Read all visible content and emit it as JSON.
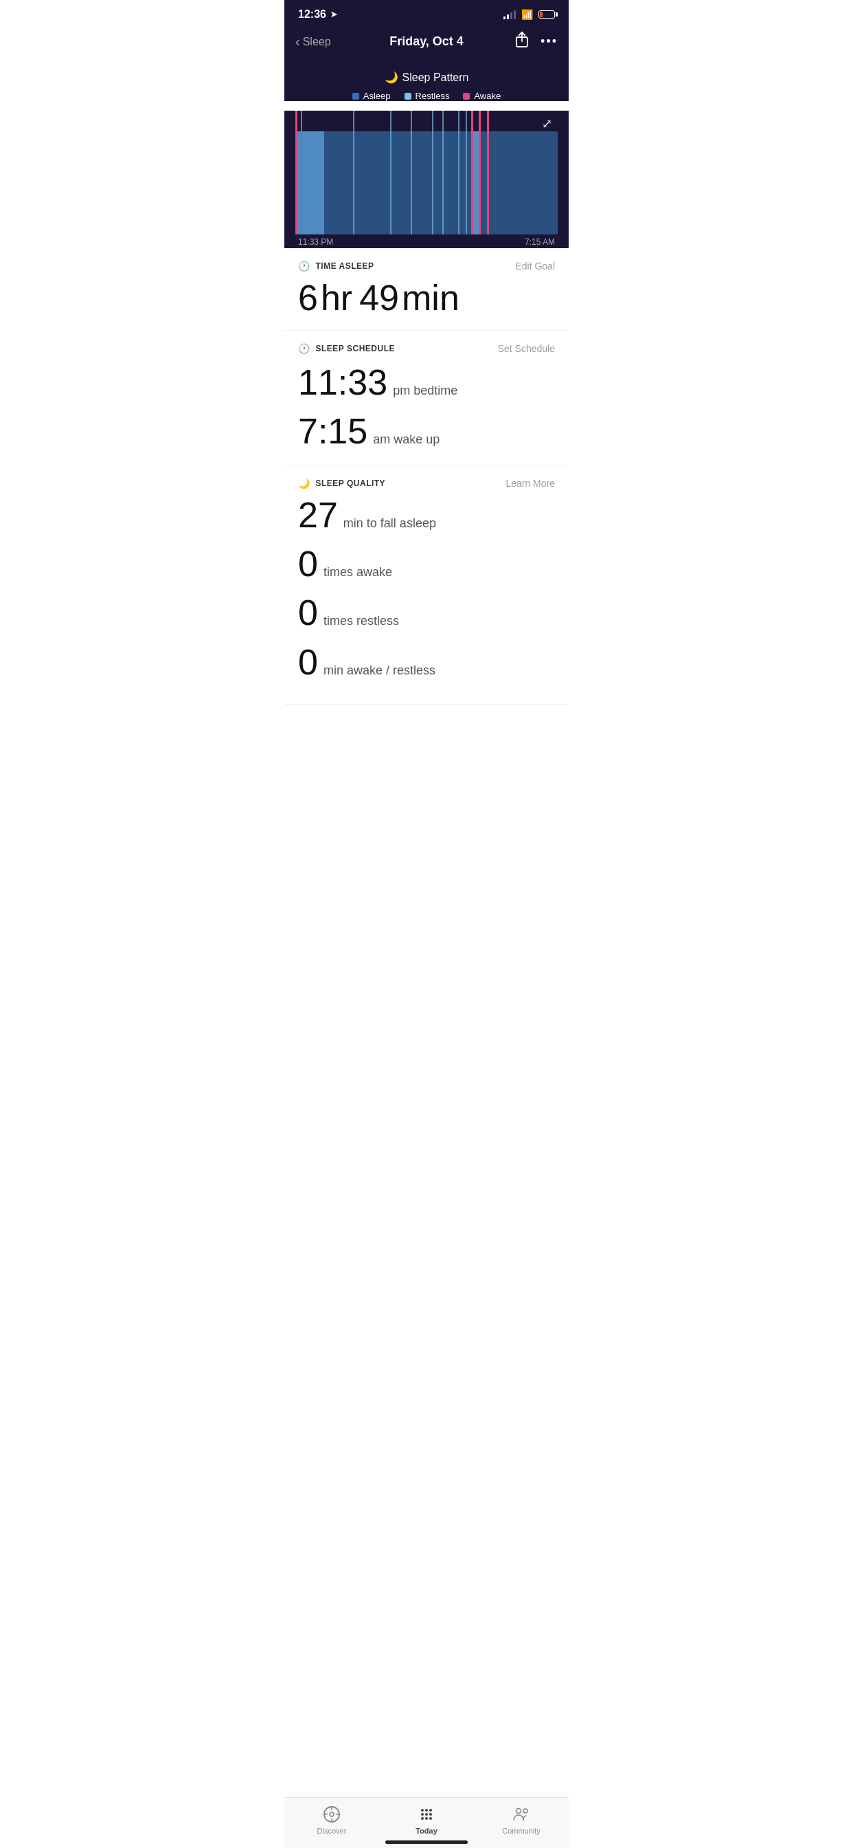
{
  "statusBar": {
    "time": "12:36",
    "hasLocation": true
  },
  "header": {
    "backLabel": "Sleep",
    "title": "Friday, Oct 4"
  },
  "sleepPattern": {
    "title": "Sleep Pattern",
    "legend": [
      {
        "label": "Asleep",
        "color": "#3a6eb5"
      },
      {
        "label": "Restless",
        "color": "#7bbfea"
      },
      {
        "label": "Awake",
        "color": "#e8437a"
      }
    ],
    "startTime": "11:33 PM",
    "endTime": "7:15 AM"
  },
  "timeAsleep": {
    "sectionTitle": "TIME ASLEEP",
    "actionLabel": "Edit Goal",
    "hours": "6",
    "hoursUnit": "hr",
    "minutes": "49",
    "minutesUnit": "min"
  },
  "sleepSchedule": {
    "sectionTitle": "SLEEP SCHEDULE",
    "actionLabel": "Set Schedule",
    "bedtime": "11:33",
    "bedtimeLabel": "pm bedtime",
    "wakeup": "7:15",
    "wakeupLabel": "am wake up"
  },
  "sleepQuality": {
    "sectionTitle": "SLEEP QUALITY",
    "actionLabel": "Learn More",
    "fallAsleepMin": "27",
    "fallAsleepLabel": "min to fall asleep",
    "timesAwake": "0",
    "timesAwakeLabel": "times awake",
    "timesRestless": "0",
    "timesRestlessLabel": "times restless",
    "minAwakeRestless": "0",
    "minAwakeRestlessLabel": "min awake / restless"
  },
  "bottomNav": {
    "items": [
      {
        "label": "Discover",
        "icon": "compass",
        "active": false
      },
      {
        "label": "Today",
        "icon": "dots-grid",
        "active": true
      },
      {
        "label": "Community",
        "icon": "community",
        "active": false
      }
    ]
  }
}
